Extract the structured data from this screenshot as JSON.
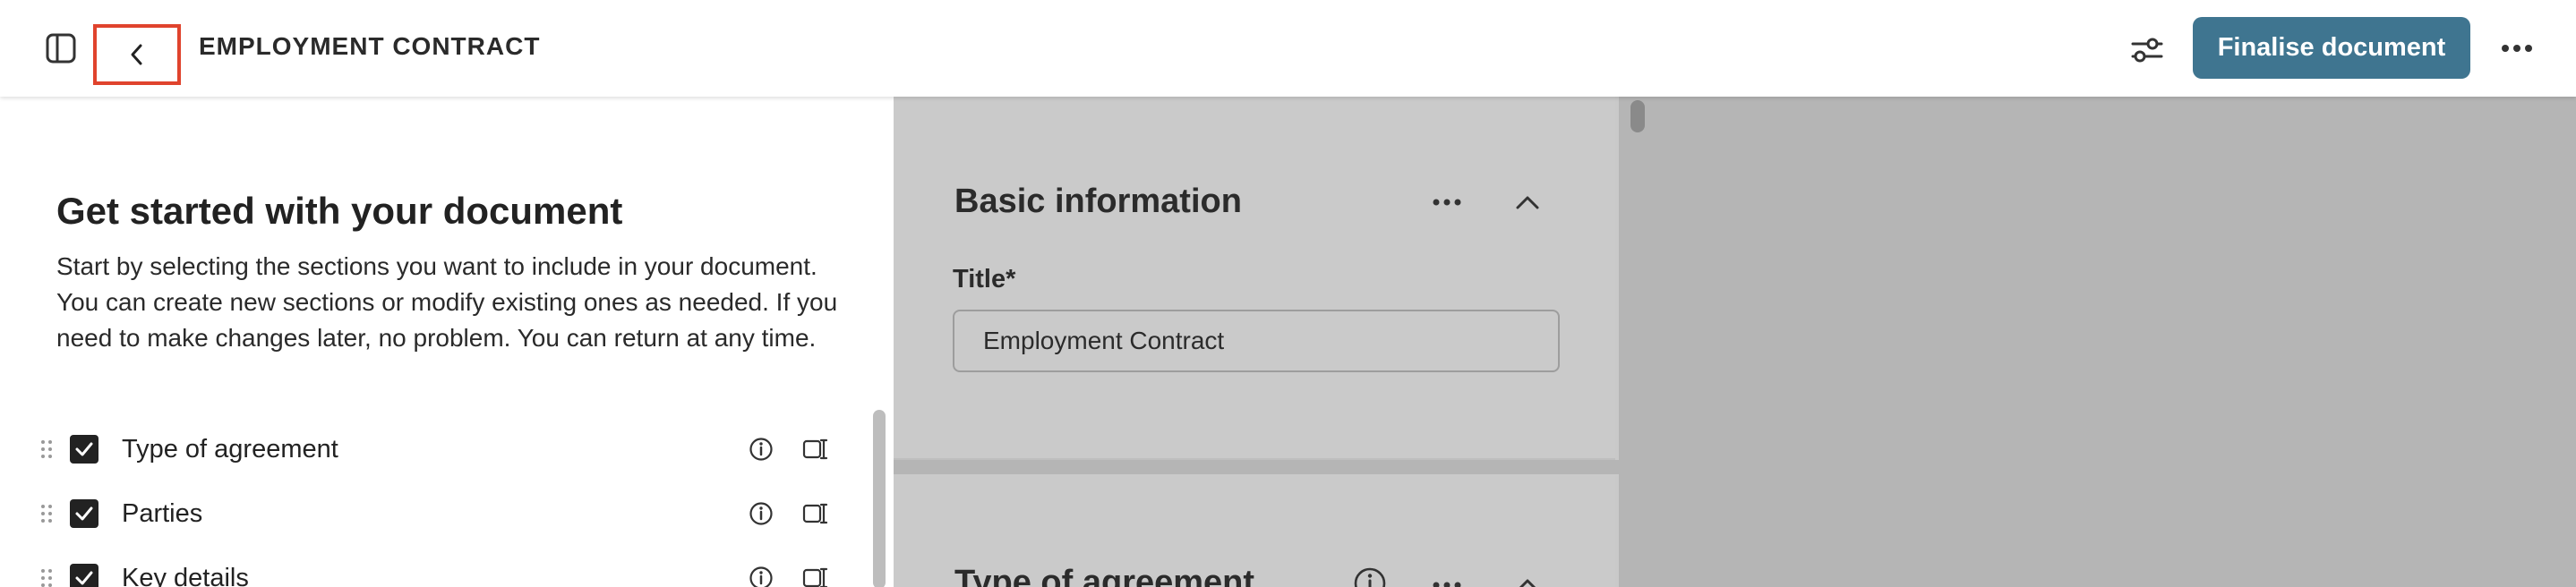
{
  "header": {
    "doc_title": "EMPLOYMENT CONTRACT",
    "finalise_label": "Finalise document",
    "icons": {
      "sidebar": "sidebar-toggle-icon",
      "back": "chevron-left-icon",
      "settings": "sliders-icon",
      "more": "more-horizontal-icon"
    },
    "accent_color": "#3f7590"
  },
  "left_panel": {
    "title": "Get started with your document",
    "description": "Start by selecting the sections you want to include in your document. You can create new sections or modify existing ones as needed. If you need to make changes later, no problem. You can return at any time.",
    "sections": [
      {
        "label": "Type of agreement",
        "checked": true
      },
      {
        "label": "Parties",
        "checked": true
      },
      {
        "label": "Key details",
        "checked": true
      }
    ]
  },
  "editor": {
    "basic_info": {
      "title": "Basic information",
      "field_label": "Title",
      "required_mark": "*",
      "field_value": "Employment Contract"
    },
    "type_of_agreement": {
      "title": "Type of agreement"
    }
  }
}
